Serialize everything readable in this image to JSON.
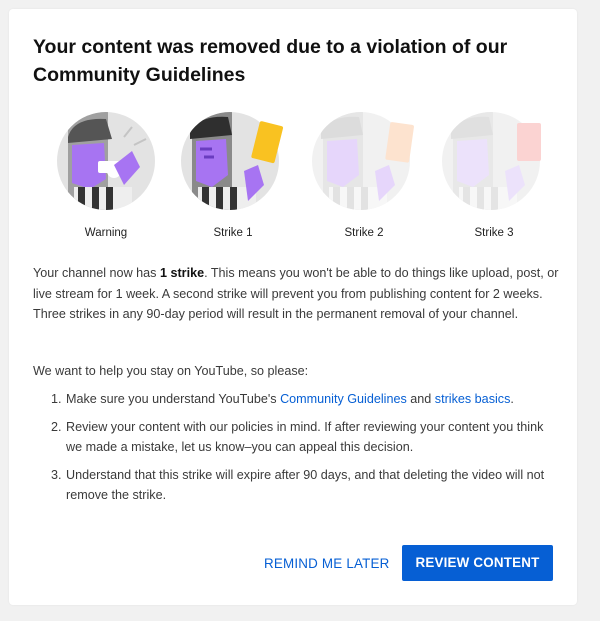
{
  "dialog": {
    "title": "Your content was removed due to a violation of our Community Guidelines",
    "strikes": [
      {
        "label": "Warning"
      },
      {
        "label": "Strike 1"
      },
      {
        "label": "Strike 2"
      },
      {
        "label": "Strike 3"
      }
    ],
    "body": {
      "p1_before": "Your channel now has ",
      "p1_bold": "1 strike",
      "p1_after": ". This means you won't be able to do things like upload, post, or live stream for 1 week. A second strike will prevent you from publishing content for 2 weeks. Three strikes in any 90-day period will result in the permanent removal of your channel.",
      "help_intro": "We want to help you stay on YouTube, so please:"
    },
    "steps": [
      {
        "num": "1.",
        "before": "Make sure you understand YouTube's ",
        "link1": "Community Guidelines",
        "middle": " and ",
        "link2": "strikes basics",
        "after": "."
      },
      {
        "num": "2.",
        "text": "Review your content with our policies in mind. If after reviewing your content you think we made a mistake, let us know–you can appeal this decision."
      },
      {
        "num": "3.",
        "text": "Understand that this strike will expire after 90 days, and that deleting the video will not remove the strike."
      }
    ],
    "buttons": {
      "remind_later": "REMIND ME LATER",
      "review_content": "REVIEW CONTENT"
    }
  },
  "colors": {
    "accent_blue": "#065fd4",
    "purple": "#a774f2",
    "card_yellow": "#f9c221",
    "card_red": "#ef5350"
  }
}
